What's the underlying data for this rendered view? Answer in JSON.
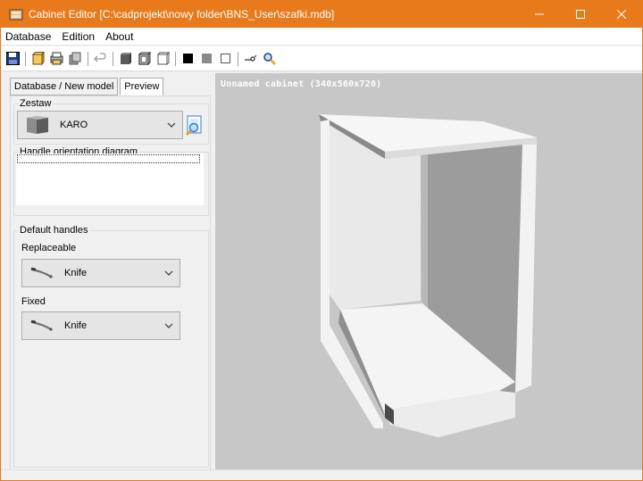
{
  "window": {
    "title": "Cabinet Editor [C:\\cadprojekt\\nowy folder\\BNS_User\\szafki.mdb]",
    "accent_color": "#e87a1c",
    "controls": {
      "minimize": "—",
      "maximize": "☐",
      "close": "✕"
    }
  },
  "menu": {
    "items": [
      {
        "label": "Database"
      },
      {
        "label": "Edition"
      },
      {
        "label": "About"
      }
    ]
  },
  "toolbar": {
    "icons": [
      "save-icon",
      "open-cabinet-icon",
      "print-icon",
      "copy-icon",
      "undo-icon",
      "box-solid-icon",
      "box-outline-icon",
      "box-wire-icon",
      "color-black-icon",
      "color-gray-icon",
      "color-white-icon",
      "handle-icon",
      "zoom-icon"
    ]
  },
  "tabs": [
    {
      "label": "Database / New model",
      "active": false
    },
    {
      "label": "Preview",
      "active": true
    }
  ],
  "zestaw": {
    "legend": "Zestaw",
    "selected": "KARO"
  },
  "handle_orientation": {
    "legend": "Handle orientation diagram"
  },
  "default_handles": {
    "legend": "Default handles",
    "replaceable_label": "Replaceable",
    "replaceable_value": "Knife",
    "fixed_label": "Fixed",
    "fixed_value": "Knife"
  },
  "viewport": {
    "label": "Unnamed cabinet (340x560x720)",
    "background": "#c7c7c7"
  }
}
